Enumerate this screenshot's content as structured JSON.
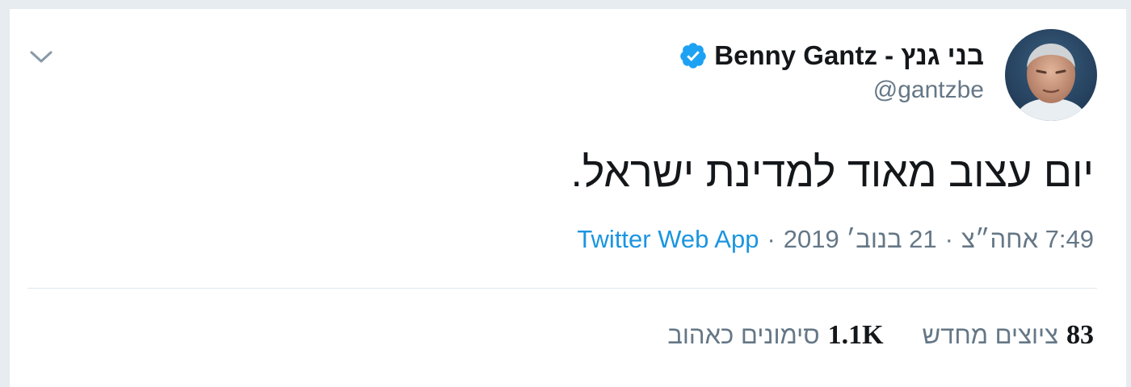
{
  "tweet": {
    "author": {
      "display_name": "Benny Gantz - בני גנץ",
      "handle": "@gantzbe",
      "verified_icon": "verified-badge-icon",
      "avatar_icon": "avatar-photo"
    },
    "text": "יום עצוב מאוד למדינת ישראל.",
    "time": "7:49 אחה״צ",
    "date": "21 בנוב׳ 2019",
    "separator": "·",
    "source": "Twitter Web App",
    "stats": {
      "retweets_count": "83",
      "retweets_label": "ציוצים מחדש",
      "likes_count": "1.1K",
      "likes_label": "סימונים כאהוב"
    },
    "menu_icon": "chevron-down-icon"
  },
  "colors": {
    "text": "#14171a",
    "secondary": "#657786",
    "link": "#1b95e0",
    "verified": "#1da1f2",
    "divider": "#e1e8ed"
  }
}
